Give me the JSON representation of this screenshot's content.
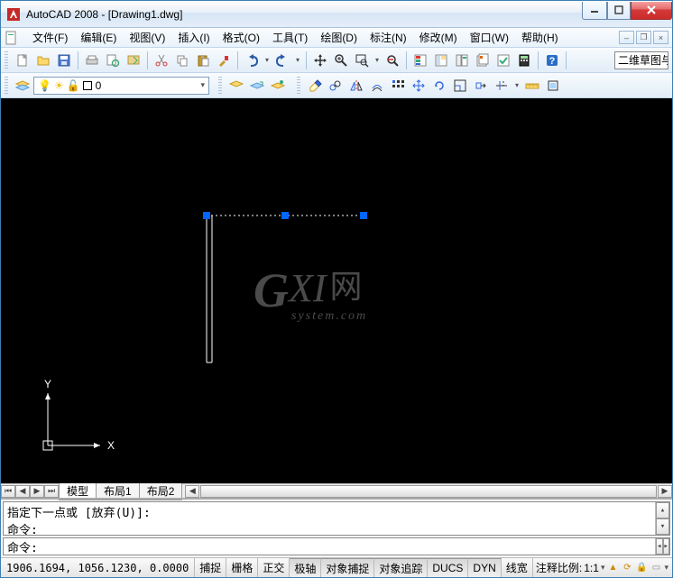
{
  "title": "AutoCAD 2008 - [Drawing1.dwg]",
  "menu": {
    "file": "文件(F)",
    "edit": "编辑(E)",
    "view": "视图(V)",
    "insert": "插入(I)",
    "format": "格式(O)",
    "tools": "工具(T)",
    "draw": "绘图(D)",
    "dimension": "标注(N)",
    "modify": "修改(M)",
    "window": "窗口(W)",
    "help": "帮助(H)"
  },
  "layer": {
    "current": "0"
  },
  "workspace": "二维草图与",
  "tabs": {
    "model": "模型",
    "layout1": "布局1",
    "layout2": "布局2"
  },
  "cmd": {
    "hist1": "指定下一点或 [放弃(U)]:",
    "hist2": "命令:",
    "prompt": "命令:"
  },
  "status": {
    "coords": "1906.1694, 1056.1230, 0.0000",
    "snap": "捕捉",
    "grid": "栅格",
    "ortho": "正交",
    "polar": "极轴",
    "osnap": "对象捕捉",
    "otrack": "对象追踪",
    "ducs": "DUCS",
    "dyn": "DYN",
    "lwt": "线宽",
    "scale_label": "注释比例:",
    "scale": "1:1"
  },
  "watermark": {
    "g": "G",
    "xi": "XI",
    "cn": "网",
    "sub": "system.com"
  },
  "axis": {
    "x": "X",
    "y": "Y"
  }
}
